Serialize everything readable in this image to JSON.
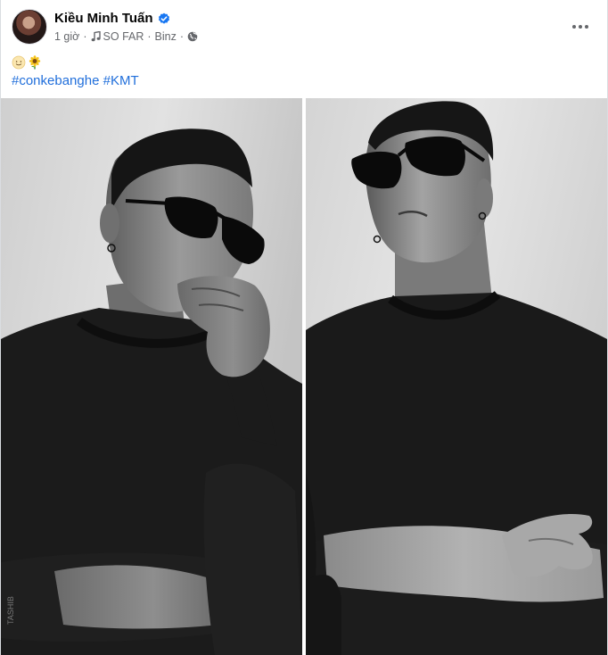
{
  "post": {
    "author": {
      "name": "Kiều Minh Tuấn",
      "avatar_icon": "profile-avatar",
      "verified_icon": "verified-badge-icon",
      "verified_color": "#1877f2"
    },
    "meta": {
      "time": "1 giờ",
      "separator": "·",
      "music_icon": "music-note-icon",
      "song": "SO FAR",
      "artist": "Binz",
      "privacy_icon": "globe-icon"
    },
    "more_icon": "more-horizontal-icon",
    "emojis": [
      "smiling-face-emoji",
      "sunflower-emoji"
    ],
    "hashtags": [
      "#conkebanghe",
      "#KMT"
    ],
    "hashtag_color": "#216fdb",
    "photos": [
      {
        "subject": "man in sunglasses, hand on chin, black shirt, black and white photo"
      },
      {
        "subject": "man in sunglasses, arms crossed, black shirt, black and white photo"
      }
    ]
  }
}
